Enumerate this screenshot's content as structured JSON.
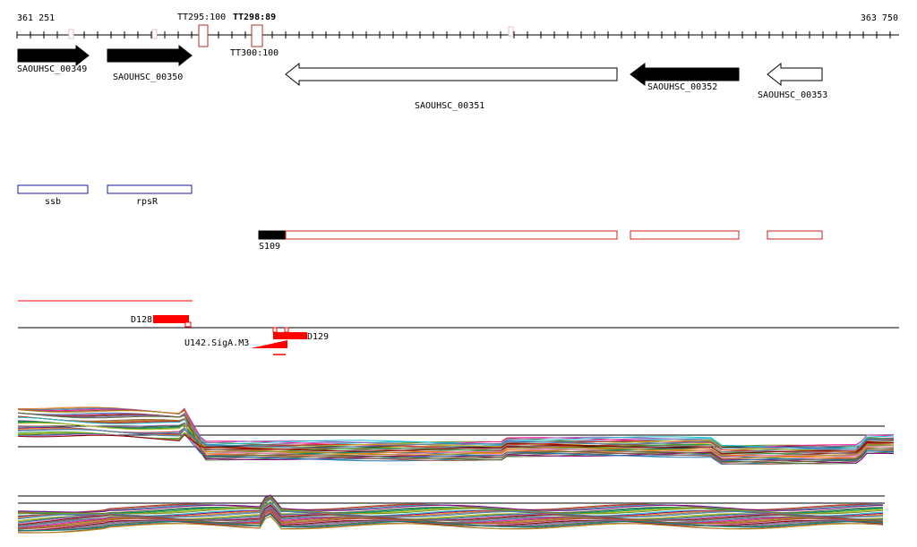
{
  "coords": {
    "start": "361 251",
    "end": "363 750"
  },
  "terminators": [
    {
      "label": "TT295:100"
    },
    {
      "label": "TT298:89"
    },
    {
      "label": "TT300:100"
    }
  ],
  "genes": [
    {
      "label": "SAOUHSC_00349",
      "strand": "+",
      "fill": "black"
    },
    {
      "label": "SAOUHSC_00350",
      "strand": "+",
      "fill": "black"
    },
    {
      "label": "SAOUHSC_00351",
      "strand": "-",
      "fill": "white"
    },
    {
      "label": "SAOUHSC_00352",
      "strand": "-",
      "fill": "black"
    },
    {
      "label": "SAOUHSC_00353",
      "strand": "-",
      "fill": "white"
    }
  ],
  "annotations": [
    {
      "label": "ssb"
    },
    {
      "label": "rpsR"
    }
  ],
  "segments": {
    "labeled": {
      "label": "S109"
    }
  },
  "features": {
    "d128": "D128",
    "d129": "D129",
    "promoter": "U142.SigA.M3"
  },
  "colors": {
    "gene_fill": "#000000",
    "annotation_outline": "#1a1aa6",
    "segment_outline": "#cc1f1f",
    "feature_red": "#ff0000",
    "terminator_outline": "#a83232"
  },
  "icons": {
    "gene_arrow": "arrow-shape",
    "terminator": "hairpin-box"
  }
}
